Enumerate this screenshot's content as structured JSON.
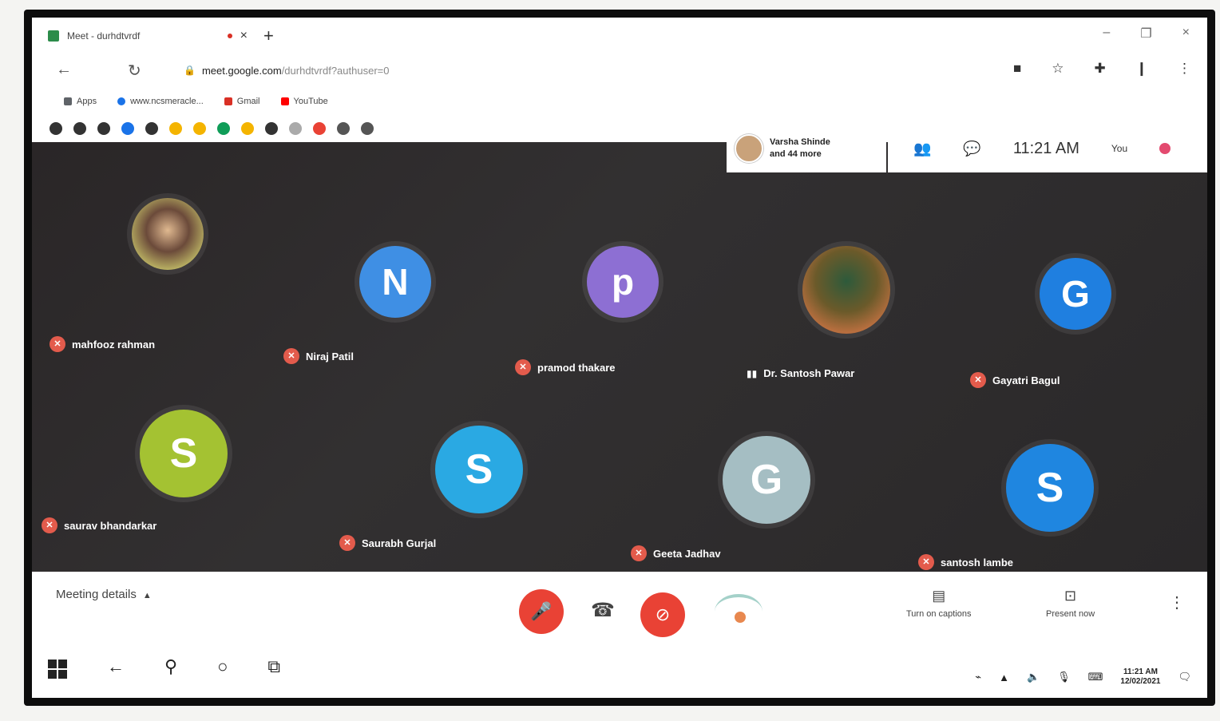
{
  "browser": {
    "tab_title": "Meet - durhdtvrdf",
    "tab_close": "×",
    "new_tab": "+",
    "window_controls": [
      "–",
      "❐",
      "×"
    ],
    "back": "←",
    "reload": "↻",
    "url_domain": "meet.google.com",
    "url_path": "/durhdtvrdf?authuser=0",
    "bookmarks": [
      {
        "label": "Apps",
        "color": "#5f6368"
      },
      {
        "label": "www.ncsmeracle...",
        "color": "#1a73e8"
      },
      {
        "label": "Gmail",
        "color": "#d93025"
      },
      {
        "label": "YouTube",
        "color": "#ff0000"
      }
    ],
    "extension_colors": [
      "#333",
      "#333",
      "#333",
      "#1a73e8",
      "#333",
      "#f4b400",
      "#f4b400",
      "#0f9d58",
      "#f4b400",
      "#333",
      "#aaa",
      "#e94235",
      "#555",
      "#555"
    ]
  },
  "meet": {
    "speaker_name": "Varsha Shinde",
    "speaker_more": "and 44 more",
    "time": "11:21 AM",
    "you_label": "You",
    "participants": [
      {
        "name": "mahfooz rahman",
        "initial": "",
        "color": "photo2"
      },
      {
        "name": "Niraj Patil",
        "initial": "N",
        "color": "#3f8fe4"
      },
      {
        "name": "pramod thakare",
        "initial": "p",
        "color": "#8d6fd3"
      },
      {
        "name": "Dr. Santosh Pawar",
        "initial": "",
        "color": "photo"
      },
      {
        "name": "Gayatri Bagul",
        "initial": "G",
        "color": "#1f7fe0"
      },
      {
        "name": "saurav bhandarkar",
        "initial": "S",
        "color": "#a4c232"
      },
      {
        "name": "Saurabh Gurjal",
        "initial": "S",
        "color": "#2aa9e3"
      },
      {
        "name": "Geeta Jadhav",
        "initial": "G",
        "color": "#a5bec3"
      },
      {
        "name": "santosh lambe",
        "initial": "S",
        "color": "#1f86e0"
      }
    ],
    "meeting_details": "Meeting details",
    "captions_label": "Turn on captions",
    "present_label": "Present now",
    "more_icon": "⋮"
  },
  "taskbar": {
    "clock_time": "11:21 AM",
    "clock_date": "12/02/2021"
  }
}
